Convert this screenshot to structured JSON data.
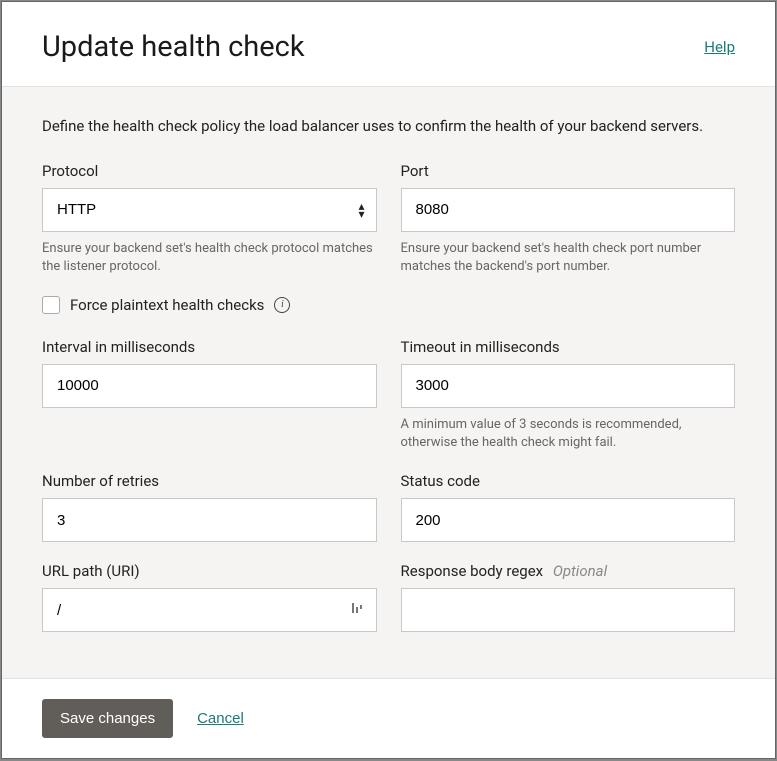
{
  "header": {
    "title": "Update health check",
    "help_label": "Help"
  },
  "description": "Define the health check policy the load balancer uses to confirm the health of your backend servers.",
  "fields": {
    "protocol": {
      "label": "Protocol",
      "value": "HTTP",
      "helper": "Ensure your backend set's health check protocol matches the listener protocol."
    },
    "port": {
      "label": "Port",
      "value": "8080",
      "helper": "Ensure your backend set's health check port number matches the backend's port number."
    },
    "force_plaintext": {
      "label": "Force plaintext health checks",
      "checked": false
    },
    "interval": {
      "label": "Interval in milliseconds",
      "value": "10000"
    },
    "timeout": {
      "label": "Timeout in milliseconds",
      "value": "3000",
      "helper": "A minimum value of 3 seconds is recommended, otherwise the health check might fail."
    },
    "retries": {
      "label": "Number of retries",
      "value": "3"
    },
    "status_code": {
      "label": "Status code",
      "value": "200"
    },
    "url_path": {
      "label": "URL path (URI)",
      "value": "/"
    },
    "response_regex": {
      "label": "Response body regex",
      "optional_label": "Optional",
      "value": ""
    }
  },
  "footer": {
    "save_label": "Save changes",
    "cancel_label": "Cancel"
  }
}
